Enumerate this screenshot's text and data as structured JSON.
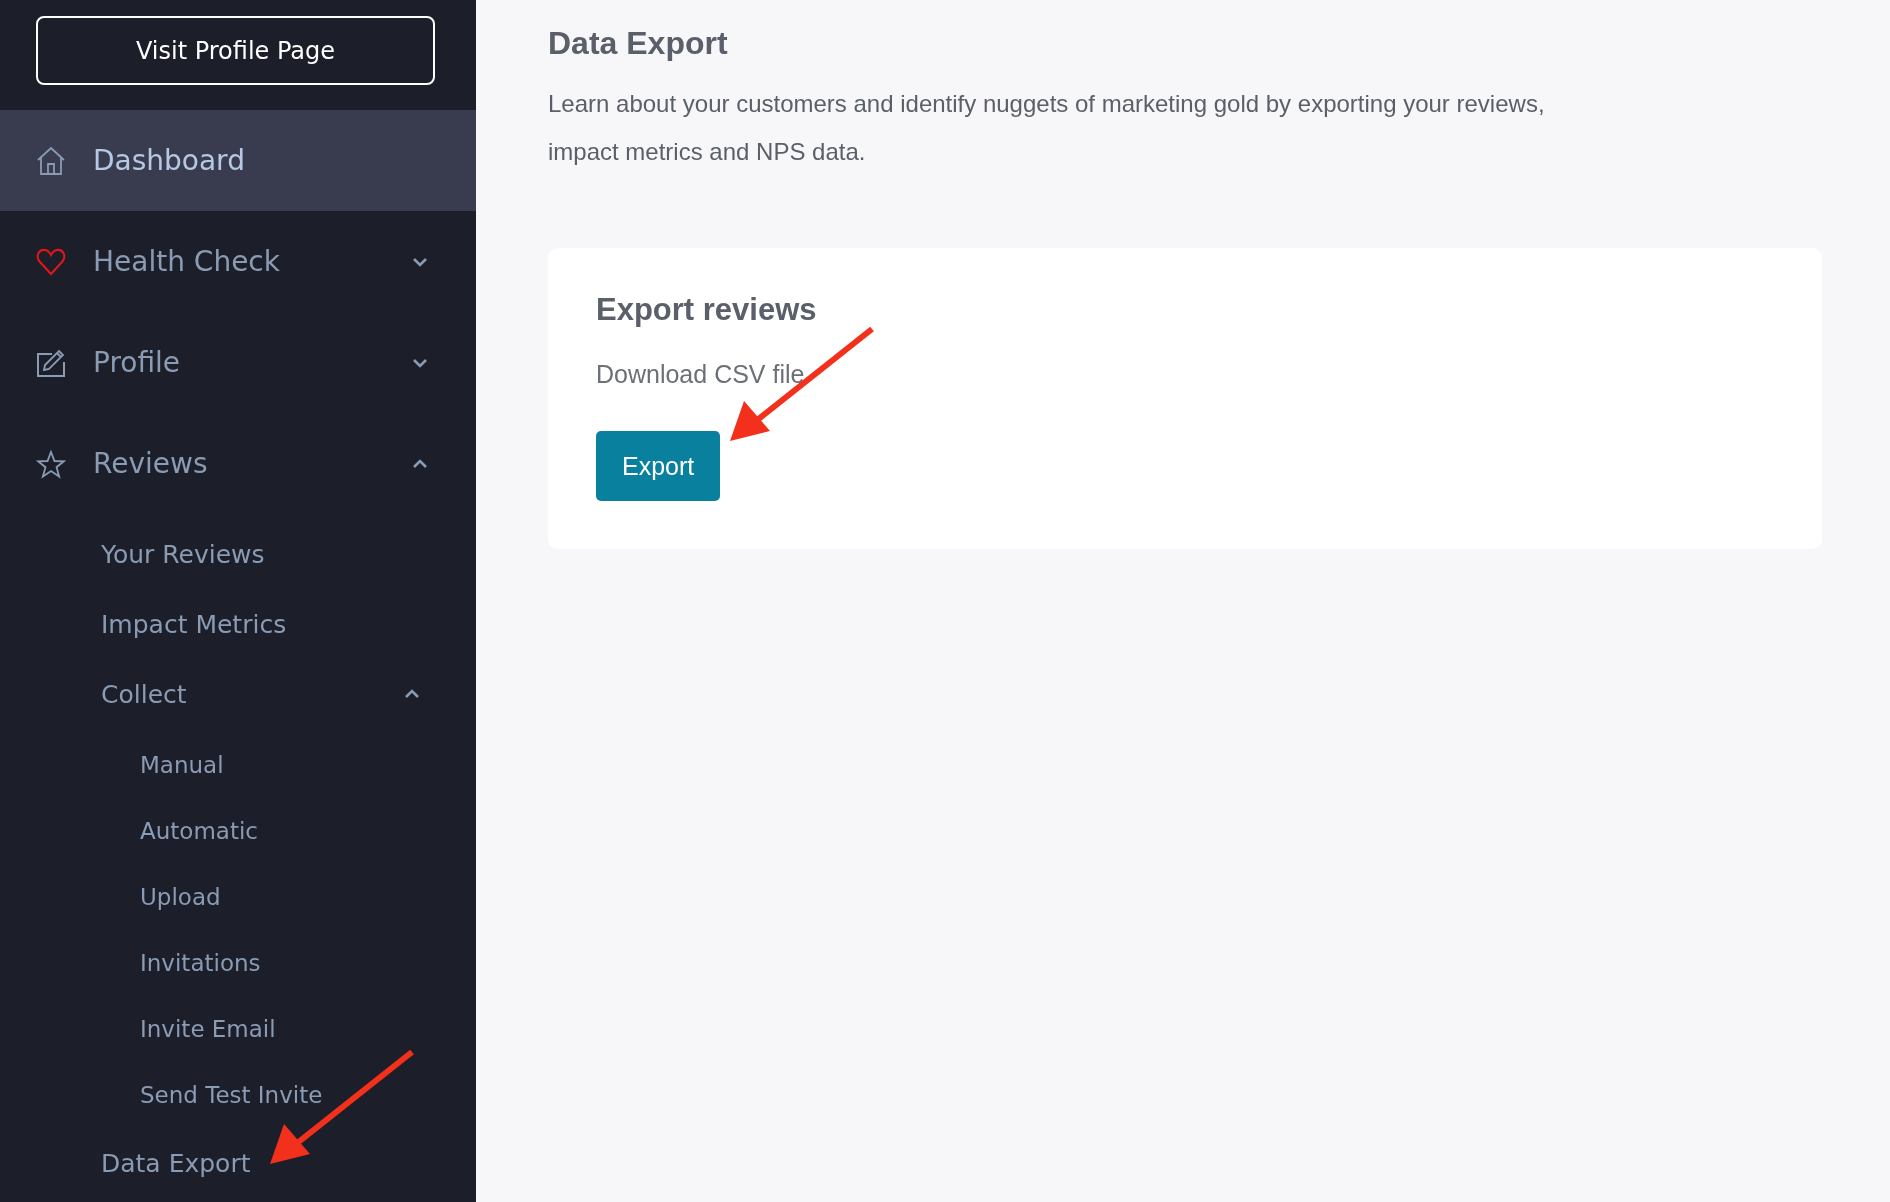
{
  "profile_button": "Visit Profile Page",
  "nav": [
    {
      "label": "Dashboard",
      "kind": "link",
      "selected": true
    },
    {
      "label": "Health Check",
      "kind": "group",
      "selected": false,
      "expanded": false
    },
    {
      "label": "Profile",
      "kind": "group",
      "selected": false,
      "expanded": false
    },
    {
      "label": "Reviews",
      "kind": "group",
      "selected": false,
      "expanded": true,
      "children": [
        {
          "label": "Your Reviews",
          "kind": "link",
          "selected": false
        },
        {
          "label": "Impact Metrics",
          "kind": "link",
          "selected": false
        },
        {
          "label": "Collect",
          "kind": "group",
          "selected": false,
          "expanded": true,
          "children": [
            {
              "label": "Manual",
              "selected": false
            },
            {
              "label": "Automatic",
              "selected": false
            },
            {
              "label": "Upload",
              "selected": false
            },
            {
              "label": "Invitations",
              "selected": false
            },
            {
              "label": "Invite Email",
              "selected": false
            },
            {
              "label": "Send Test Invite",
              "selected": false
            }
          ]
        },
        {
          "label": "Data Export",
          "kind": "link",
          "selected": false
        }
      ]
    }
  ],
  "page": {
    "title": "Data Export",
    "description": "Learn about your customers and identify nuggets of marketing gold by exporting your reviews, impact metrics and NPS data."
  },
  "card": {
    "title": "Export reviews",
    "subtitle": "Download CSV file",
    "button": "Export"
  }
}
